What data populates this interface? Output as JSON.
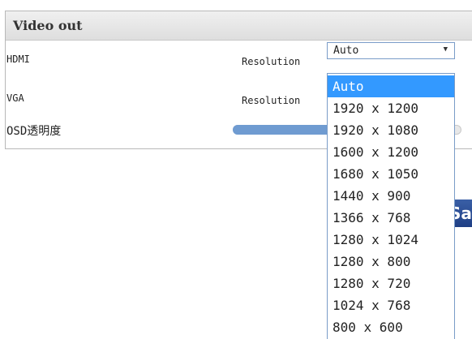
{
  "panel": {
    "title": "Video out"
  },
  "rows": [
    {
      "label": "HDMI",
      "resolution_label": "Resolution",
      "resolution_value": "Auto"
    },
    {
      "label": "VGA",
      "resolution_label": "Resolution",
      "resolution_value": ""
    },
    {
      "label": "OSD透明度",
      "slider_fraction": 0.53
    }
  ],
  "dropdown": {
    "options": [
      "Auto",
      "1920 x 1200",
      "1920 x 1080",
      "1600 x 1200",
      "1680 x 1050",
      "1440 x 900",
      "1366 x 768",
      "1280 x 1024",
      "1280 x 800",
      "1280 x 720",
      "1024 x 768",
      "800 x 600"
    ],
    "selected_index": 0
  },
  "save_button": {
    "label": "Save"
  },
  "colors": {
    "highlight": "#3399ff",
    "slider": "#6f9bd1",
    "button": "#2a4d96"
  },
  "icons": {
    "select_arrow": "dropdown-arrow-icon"
  }
}
